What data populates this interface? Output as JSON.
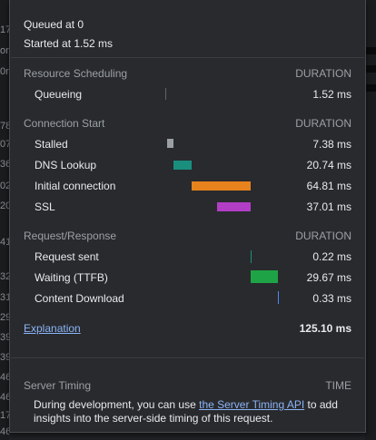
{
  "background_left": [
    "17",
    "on",
    "0n",
    "78",
    "07",
    "36",
    "02",
    "20",
    "41",
    "32",
    "31",
    "29",
    "39",
    "39",
    "46",
    "46",
    "17",
    "46"
  ],
  "header": {
    "queued": "Queued at 0",
    "started": "Started at 1.52 ms"
  },
  "resource_scheduling": {
    "title": "Resource Scheduling",
    "duration_label": "DURATION",
    "rows": [
      {
        "label": "Queueing",
        "value": "1.52 ms"
      }
    ]
  },
  "connection_start": {
    "title": "Connection Start",
    "duration_label": "DURATION",
    "rows": [
      {
        "label": "Stalled",
        "value": "7.38 ms",
        "color": "#9aa0a6"
      },
      {
        "label": "DNS Lookup",
        "value": "20.74 ms",
        "color": "#1a8f7e"
      },
      {
        "label": "Initial connection",
        "value": "64.81 ms",
        "color": "#e8821c"
      },
      {
        "label": "SSL",
        "value": "37.01 ms",
        "color": "#b23ec6"
      }
    ]
  },
  "request_response": {
    "title": "Request/Response",
    "duration_label": "DURATION",
    "rows": [
      {
        "label": "Request sent",
        "value": "0.22 ms",
        "color": "#1a8f7e"
      },
      {
        "label": "Waiting (TTFB)",
        "value": "29.67 ms",
        "color": "#1ea446"
      },
      {
        "label": "Content Download",
        "value": "0.33 ms",
        "color": "#4c8df6"
      }
    ]
  },
  "explanation": {
    "link": "Explanation",
    "total": "125.10 ms"
  },
  "server_timing": {
    "title": "Server Timing",
    "time_label": "TIME",
    "text_before": "During development, you can use ",
    "link": "the Server Timing API",
    "text_after": " to add insights into the server-side timing of this request."
  }
}
